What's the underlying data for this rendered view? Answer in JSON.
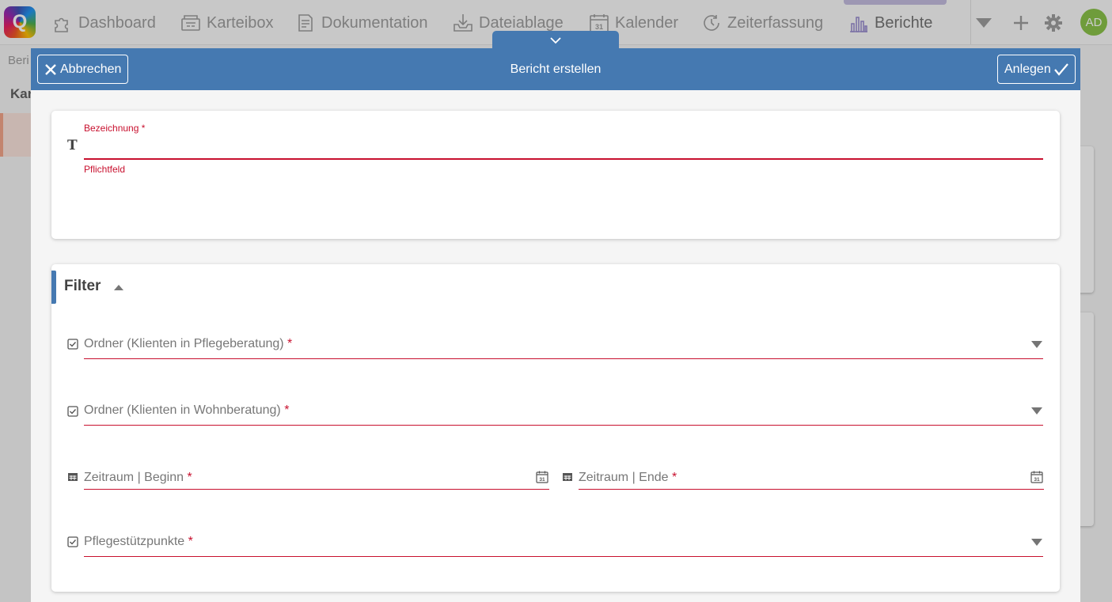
{
  "nav": {
    "logo_letter": "Q",
    "items": [
      {
        "label": "Dashboard",
        "icon": "puzzle-icon"
      },
      {
        "label": "Karteibox",
        "icon": "card-box-icon"
      },
      {
        "label": "Dokumentation",
        "icon": "document-icon"
      },
      {
        "label": "Dateiablage",
        "icon": "download-tray-icon"
      },
      {
        "label": "Kalender",
        "icon": "calendar-icon"
      },
      {
        "label": "Zeiterfassung",
        "icon": "clock-icon"
      },
      {
        "label": "Berichte",
        "icon": "bar-chart-icon"
      }
    ],
    "active_item": "Berichte",
    "user_initials": "AD"
  },
  "background": {
    "breadcrumb": "Beri",
    "heading": "Kar"
  },
  "dialog": {
    "title": "Bericht erstellen",
    "cancel_label": "Abbrechen",
    "create_label": "Anlegen",
    "name_field": {
      "label": "Bezeichnung *",
      "value": "",
      "error": "Pflichtfeld"
    },
    "filter": {
      "title": "Filter",
      "expanded": true,
      "fields": [
        {
          "label": "Ordner (Klienten in Pflegeberatung)",
          "required_mark": "*",
          "type": "multiselect"
        },
        {
          "label": "Ordner (Klienten in Wohnberatung)",
          "required_mark": "*",
          "type": "multiselect"
        },
        {
          "label": "Zeitraum | Beginn",
          "required_mark": "*",
          "type": "date"
        },
        {
          "label": "Zeitraum | Ende",
          "required_mark": "*",
          "type": "date"
        },
        {
          "label": "Pflegestützpunkte",
          "required_mark": "*",
          "type": "multiselect"
        }
      ]
    }
  },
  "colors": {
    "header_blue": "#4579b1",
    "required_red": "#c8102e",
    "active_tab": "#c5bde0",
    "avatar_green": "#8bc34a"
  }
}
